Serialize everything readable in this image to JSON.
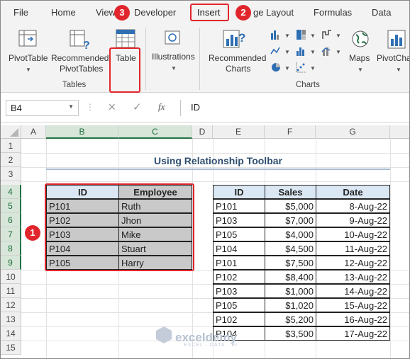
{
  "tabs": [
    "File",
    "Home",
    "View",
    "Developer",
    "Insert",
    "ge Layout",
    "Formulas",
    "Data"
  ],
  "badges": {
    "one": "1",
    "two": "2",
    "three": "3"
  },
  "ribbon": {
    "pivot": "PivotTable",
    "rec_pivot_1": "Recommended",
    "rec_pivot_2": "PivotTables",
    "table": "Table",
    "illustrations": "Illustrations",
    "rec_charts_1": "Recommended",
    "rec_charts_2": "Charts",
    "maps": "Maps",
    "pivotchart": "PivotChar",
    "group_tables": "Tables",
    "group_charts": "Charts"
  },
  "formula_bar": {
    "name_box": "B4",
    "fx": "fx",
    "value": "ID"
  },
  "columns": [
    "A",
    "B",
    "C",
    "D",
    "E",
    "F",
    "G"
  ],
  "rows": [
    "1",
    "2",
    "3",
    "4",
    "5",
    "6",
    "7",
    "8",
    "9",
    "10",
    "11",
    "12",
    "13",
    "14",
    "15"
  ],
  "sheet_title": "Using Relationship Toolbar",
  "table1": {
    "headers": [
      "ID",
      "Employee"
    ],
    "rows": [
      [
        "P101",
        "Ruth"
      ],
      [
        "P102",
        "Jhon"
      ],
      [
        "P103",
        "Mike"
      ],
      [
        "P104",
        "Stuart"
      ],
      [
        "P105",
        "Harry"
      ]
    ]
  },
  "table2": {
    "headers": [
      "ID",
      "Sales",
      "Date"
    ],
    "rows": [
      [
        "P101",
        "$5,000",
        "8-Aug-22"
      ],
      [
        "P103",
        "$7,000",
        "9-Aug-22"
      ],
      [
        "P105",
        "$4,000",
        "10-Aug-22"
      ],
      [
        "P104",
        "$4,500",
        "11-Aug-22"
      ],
      [
        "P101",
        "$7,500",
        "12-Aug-22"
      ],
      [
        "P102",
        "$8,400",
        "13-Aug-22"
      ],
      [
        "P103",
        "$1,000",
        "14-Aug-22"
      ],
      [
        "P105",
        "$1,020",
        "15-Aug-22"
      ],
      [
        "P102",
        "$5,200",
        "16-Aug-22"
      ],
      [
        "P104",
        "$3,500",
        "17-Aug-22"
      ]
    ]
  },
  "watermark": {
    "brand": "exceldemy",
    "tagline": "EXCEL · DATA · BI"
  },
  "colors": {
    "accent_red": "#e0262c",
    "excel_green": "#217346",
    "header_blue": "#dbe7f3",
    "selection_grey": "#c9c9c9"
  }
}
